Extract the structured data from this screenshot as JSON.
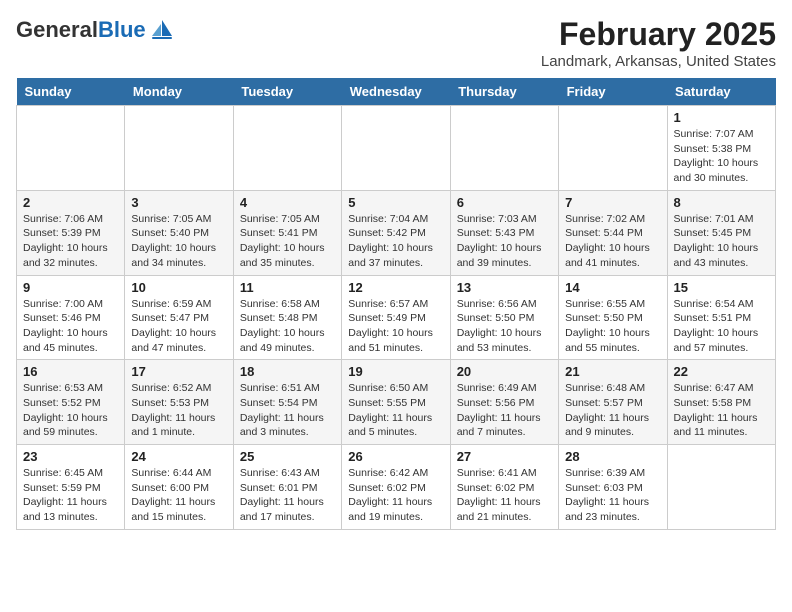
{
  "logo": {
    "text_general": "General",
    "text_blue": "Blue"
  },
  "title": "February 2025",
  "subtitle": "Landmark, Arkansas, United States",
  "days_of_week": [
    "Sunday",
    "Monday",
    "Tuesday",
    "Wednesday",
    "Thursday",
    "Friday",
    "Saturday"
  ],
  "weeks": [
    [
      {
        "day": "",
        "detail": ""
      },
      {
        "day": "",
        "detail": ""
      },
      {
        "day": "",
        "detail": ""
      },
      {
        "day": "",
        "detail": ""
      },
      {
        "day": "",
        "detail": ""
      },
      {
        "day": "",
        "detail": ""
      },
      {
        "day": "1",
        "detail": "Sunrise: 7:07 AM\nSunset: 5:38 PM\nDaylight: 10 hours\nand 30 minutes."
      }
    ],
    [
      {
        "day": "2",
        "detail": "Sunrise: 7:06 AM\nSunset: 5:39 PM\nDaylight: 10 hours\nand 32 minutes."
      },
      {
        "day": "3",
        "detail": "Sunrise: 7:05 AM\nSunset: 5:40 PM\nDaylight: 10 hours\nand 34 minutes."
      },
      {
        "day": "4",
        "detail": "Sunrise: 7:05 AM\nSunset: 5:41 PM\nDaylight: 10 hours\nand 35 minutes."
      },
      {
        "day": "5",
        "detail": "Sunrise: 7:04 AM\nSunset: 5:42 PM\nDaylight: 10 hours\nand 37 minutes."
      },
      {
        "day": "6",
        "detail": "Sunrise: 7:03 AM\nSunset: 5:43 PM\nDaylight: 10 hours\nand 39 minutes."
      },
      {
        "day": "7",
        "detail": "Sunrise: 7:02 AM\nSunset: 5:44 PM\nDaylight: 10 hours\nand 41 minutes."
      },
      {
        "day": "8",
        "detail": "Sunrise: 7:01 AM\nSunset: 5:45 PM\nDaylight: 10 hours\nand 43 minutes."
      }
    ],
    [
      {
        "day": "9",
        "detail": "Sunrise: 7:00 AM\nSunset: 5:46 PM\nDaylight: 10 hours\nand 45 minutes."
      },
      {
        "day": "10",
        "detail": "Sunrise: 6:59 AM\nSunset: 5:47 PM\nDaylight: 10 hours\nand 47 minutes."
      },
      {
        "day": "11",
        "detail": "Sunrise: 6:58 AM\nSunset: 5:48 PM\nDaylight: 10 hours\nand 49 minutes."
      },
      {
        "day": "12",
        "detail": "Sunrise: 6:57 AM\nSunset: 5:49 PM\nDaylight: 10 hours\nand 51 minutes."
      },
      {
        "day": "13",
        "detail": "Sunrise: 6:56 AM\nSunset: 5:50 PM\nDaylight: 10 hours\nand 53 minutes."
      },
      {
        "day": "14",
        "detail": "Sunrise: 6:55 AM\nSunset: 5:50 PM\nDaylight: 10 hours\nand 55 minutes."
      },
      {
        "day": "15",
        "detail": "Sunrise: 6:54 AM\nSunset: 5:51 PM\nDaylight: 10 hours\nand 57 minutes."
      }
    ],
    [
      {
        "day": "16",
        "detail": "Sunrise: 6:53 AM\nSunset: 5:52 PM\nDaylight: 10 hours\nand 59 minutes."
      },
      {
        "day": "17",
        "detail": "Sunrise: 6:52 AM\nSunset: 5:53 PM\nDaylight: 11 hours\nand 1 minute."
      },
      {
        "day": "18",
        "detail": "Sunrise: 6:51 AM\nSunset: 5:54 PM\nDaylight: 11 hours\nand 3 minutes."
      },
      {
        "day": "19",
        "detail": "Sunrise: 6:50 AM\nSunset: 5:55 PM\nDaylight: 11 hours\nand 5 minutes."
      },
      {
        "day": "20",
        "detail": "Sunrise: 6:49 AM\nSunset: 5:56 PM\nDaylight: 11 hours\nand 7 minutes."
      },
      {
        "day": "21",
        "detail": "Sunrise: 6:48 AM\nSunset: 5:57 PM\nDaylight: 11 hours\nand 9 minutes."
      },
      {
        "day": "22",
        "detail": "Sunrise: 6:47 AM\nSunset: 5:58 PM\nDaylight: 11 hours\nand 11 minutes."
      }
    ],
    [
      {
        "day": "23",
        "detail": "Sunrise: 6:45 AM\nSunset: 5:59 PM\nDaylight: 11 hours\nand 13 minutes."
      },
      {
        "day": "24",
        "detail": "Sunrise: 6:44 AM\nSunset: 6:00 PM\nDaylight: 11 hours\nand 15 minutes."
      },
      {
        "day": "25",
        "detail": "Sunrise: 6:43 AM\nSunset: 6:01 PM\nDaylight: 11 hours\nand 17 minutes."
      },
      {
        "day": "26",
        "detail": "Sunrise: 6:42 AM\nSunset: 6:02 PM\nDaylight: 11 hours\nand 19 minutes."
      },
      {
        "day": "27",
        "detail": "Sunrise: 6:41 AM\nSunset: 6:02 PM\nDaylight: 11 hours\nand 21 minutes."
      },
      {
        "day": "28",
        "detail": "Sunrise: 6:39 AM\nSunset: 6:03 PM\nDaylight: 11 hours\nand 23 minutes."
      },
      {
        "day": "",
        "detail": ""
      }
    ]
  ]
}
